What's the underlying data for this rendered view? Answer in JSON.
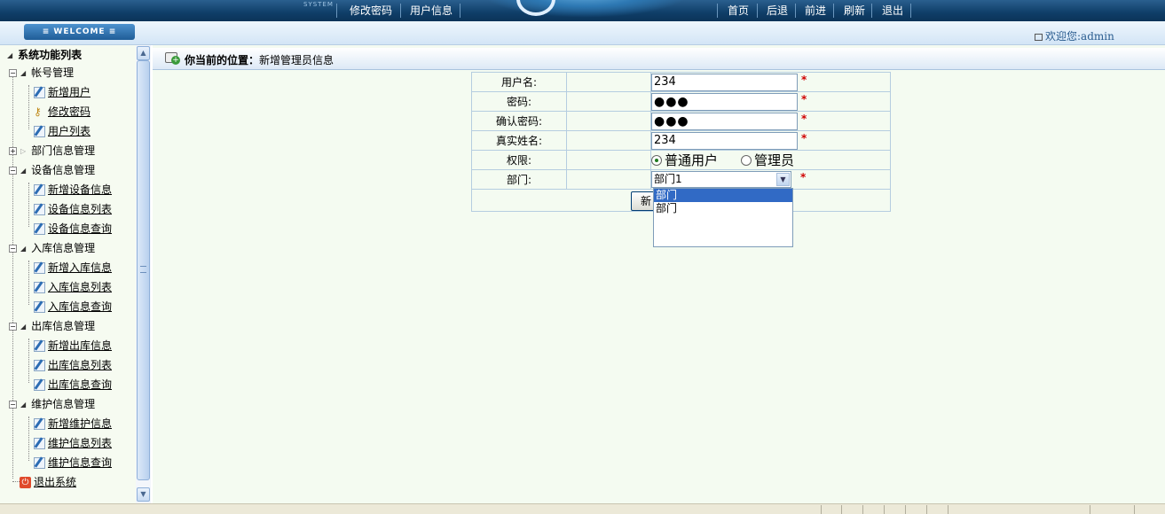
{
  "top": {
    "system_label": "SYSTEM",
    "left_links": [
      "修改密码",
      "用户信息"
    ],
    "right_links": [
      "首页",
      "后退",
      "前进",
      "刷新",
      "退出"
    ]
  },
  "strip": {
    "welcome": "≡ WELCOME ≡",
    "greeting": "欢迎您:admin"
  },
  "sidebar": {
    "root": "系统功能列表",
    "groups": [
      {
        "label": "帐号管理",
        "items": [
          "新增用户",
          "修改密码",
          "用户列表"
        ]
      },
      {
        "label": "部门信息管理",
        "items": []
      },
      {
        "label": "设备信息管理",
        "items": [
          "新增设备信息",
          "设备信息列表",
          "设备信息查询"
        ]
      },
      {
        "label": "入库信息管理",
        "items": [
          "新增入库信息",
          "入库信息列表",
          "入库信息查询"
        ]
      },
      {
        "label": "出库信息管理",
        "items": [
          "新增出库信息",
          "出库信息列表",
          "出库信息查询"
        ]
      },
      {
        "label": "维护信息管理",
        "items": [
          "新增维护信息",
          "维护信息列表",
          "维护信息查询"
        ]
      }
    ],
    "exit": "退出系统"
  },
  "main": {
    "breadcrumb_prefix": "你当前的位置：",
    "breadcrumb_page": "新增管理员信息",
    "form": {
      "username_label": "用户名:",
      "username_value": "234",
      "password_label": "密码:",
      "password_value": "●●●",
      "confirm_label": "确认密码:",
      "confirm_value": "●●●",
      "realname_label": "真实姓名:",
      "realname_value": "234",
      "role_label": "权限:",
      "role_options": [
        "普通用户",
        "管理员"
      ],
      "role_selected": "普通用户",
      "dept_label": "部门:",
      "dept_selected": "部门1",
      "dept_options": [
        "部门",
        "部门"
      ],
      "required_mark": "*",
      "submit_label": "新"
    }
  },
  "colors": {
    "topbar": "#0f3e68",
    "highlight": "#316ac5",
    "required": "#d00000",
    "main_bg": "#f4fbf1"
  }
}
